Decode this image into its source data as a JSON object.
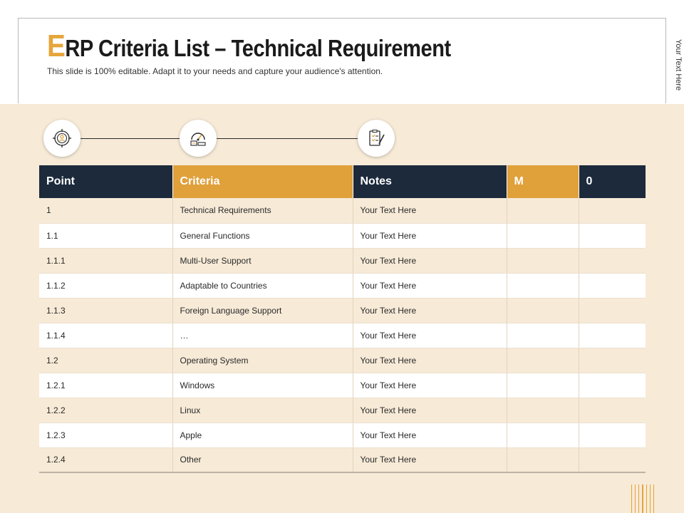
{
  "header": {
    "title_first_letter": "E",
    "title_rest": "RP Criteria List – Technical Requirement",
    "subtitle": "This slide is 100% editable. Adapt it to your needs and capture your audience's attention.",
    "side_text": "Your Text Here"
  },
  "icons": [
    "target-person-icon",
    "gauge-icon",
    "checklist-pen-icon"
  ],
  "table": {
    "headers": [
      "Point",
      "Criteria",
      "Notes",
      "M",
      "0"
    ],
    "rows": [
      [
        "1",
        "Technical Requirements",
        "Your Text Here",
        "",
        ""
      ],
      [
        "1.1",
        "General Functions",
        "Your Text Here",
        "",
        ""
      ],
      [
        "1.1.1",
        "Multi-User Support",
        "Your Text Here",
        "",
        ""
      ],
      [
        "1.1.2",
        "Adaptable to Countries",
        "Your Text Here",
        "",
        ""
      ],
      [
        "1.1.3",
        "Foreign Language Support",
        "Your Text Here",
        "",
        ""
      ],
      [
        "1.1.4",
        "…",
        "Your Text Here",
        "",
        ""
      ],
      [
        "1.2",
        "Operating System",
        "Your Text Here",
        "",
        ""
      ],
      [
        "1.2.1",
        "Windows",
        "Your Text Here",
        "",
        ""
      ],
      [
        "1.2.2",
        "Linux",
        "Your Text Here",
        "",
        ""
      ],
      [
        "1.2.3",
        "Apple",
        "Your Text Here",
        "",
        ""
      ],
      [
        "1.2.4",
        "Other",
        "Your Text Here",
        "",
        ""
      ]
    ]
  },
  "colors": {
    "accent": "#e0a03a",
    "dark_header": "#1c2a3c",
    "beige": "#f7ead7"
  }
}
